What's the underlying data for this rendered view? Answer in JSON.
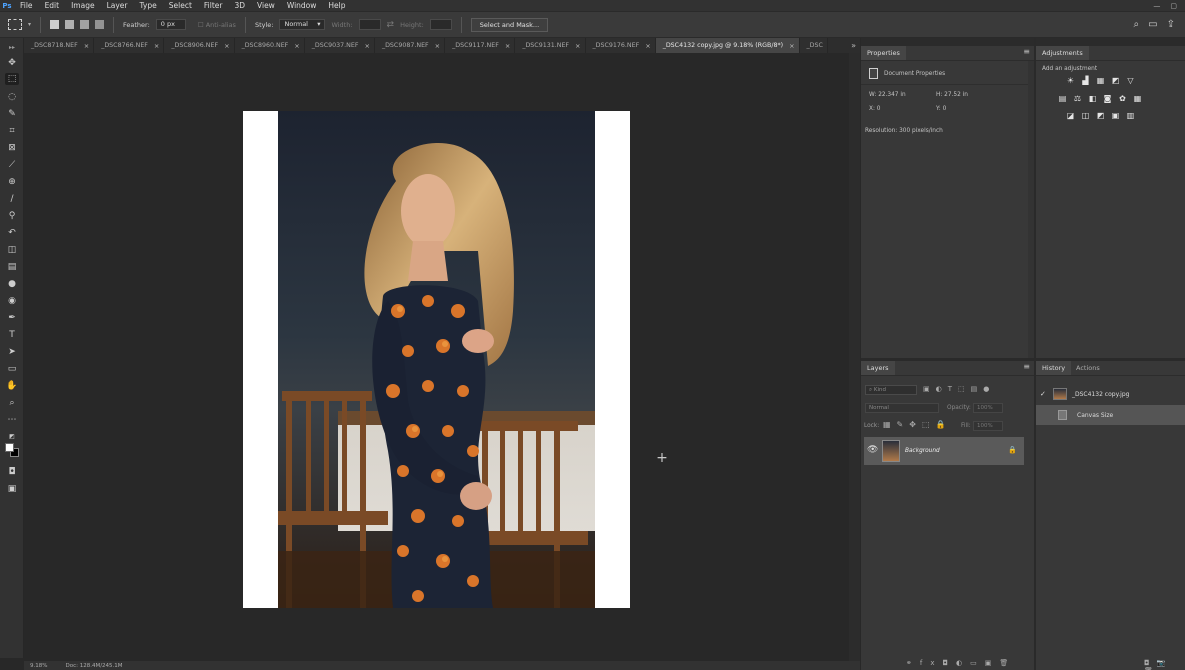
{
  "app": {
    "logo": "Ps"
  },
  "menu": [
    "File",
    "Edit",
    "Image",
    "Layer",
    "Type",
    "Select",
    "Filter",
    "3D",
    "View",
    "Window",
    "Help"
  ],
  "window_controls": [
    "—",
    "▢"
  ],
  "options": {
    "feather_label": "Feather:",
    "feather_value": "0 px",
    "antialias_label": "Anti-alias",
    "style_label": "Style:",
    "style_value": "Normal",
    "width_label": "Width:",
    "height_label": "Height:",
    "select_mask_label": "Select and Mask..."
  },
  "tabs": [
    {
      "label": "_DSC8718.NEF"
    },
    {
      "label": "_DSC8766.NEF"
    },
    {
      "label": "_DSC8906.NEF"
    },
    {
      "label": "_DSC8960.NEF"
    },
    {
      "label": "_DSC9037.NEF"
    },
    {
      "label": "_DSC9087.NEF"
    },
    {
      "label": "_DSC9117.NEF"
    },
    {
      "label": "_DSC9131.NEF"
    },
    {
      "label": "_DSC9176.NEF"
    },
    {
      "label": "_DSC4132 copy.jpg @ 9.18% (RGB/8*)"
    },
    {
      "label": "_DSC"
    }
  ],
  "tab_close": "×",
  "tab_more": "»",
  "status": {
    "zoom": "9.18%",
    "doc": "Doc: 128.4M/245.1M"
  },
  "properties": {
    "title": "Properties",
    "section": "Document Properties",
    "w_label": "W:",
    "w_value": "22.347 in",
    "h_label": "H:",
    "h_value": "27.52 in",
    "x_label": "X:",
    "x_value": "0",
    "y_label": "Y:",
    "y_value": "0",
    "resolution": "Resolution: 300 pixels/inch"
  },
  "adjustments": {
    "title": "Adjustments",
    "add_label": "Add an adjustment"
  },
  "layers": {
    "title": "Layers",
    "search_placeholder": "Kind",
    "blend_mode": "Normal",
    "opacity_label": "Opacity:",
    "opacity_value": "100%",
    "lock_label": "Lock:",
    "fill_label": "Fill:",
    "fill_value": "100%",
    "items": [
      {
        "name": "Background",
        "visible": true,
        "locked": true
      }
    ]
  },
  "history": {
    "title": "History",
    "actions_tab": "Actions",
    "snapshot": "_DSC4132 copy.jpg",
    "items": [
      "Canvas Size"
    ]
  }
}
